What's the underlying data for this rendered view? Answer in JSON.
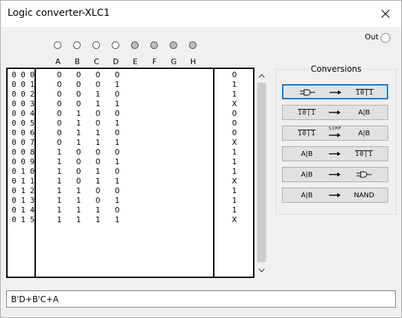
{
  "window": {
    "title": "Logic converter-XLC1"
  },
  "inputs": {
    "labels": [
      "A",
      "B",
      "C",
      "D",
      "E",
      "F",
      "G",
      "H"
    ],
    "active": [
      true,
      true,
      true,
      true,
      false,
      false,
      false,
      false
    ]
  },
  "output": {
    "label": "Out"
  },
  "truth_table": {
    "rows": [
      {
        "index": "000",
        "bits": [
          "0",
          "0",
          "0",
          "0"
        ],
        "out": "0"
      },
      {
        "index": "001",
        "bits": [
          "0",
          "0",
          "0",
          "1"
        ],
        "out": "1"
      },
      {
        "index": "002",
        "bits": [
          "0",
          "0",
          "1",
          "0"
        ],
        "out": "1"
      },
      {
        "index": "003",
        "bits": [
          "0",
          "0",
          "1",
          "1"
        ],
        "out": "X"
      },
      {
        "index": "004",
        "bits": [
          "0",
          "1",
          "0",
          "0"
        ],
        "out": "0"
      },
      {
        "index": "005",
        "bits": [
          "0",
          "1",
          "0",
          "1"
        ],
        "out": "0"
      },
      {
        "index": "006",
        "bits": [
          "0",
          "1",
          "1",
          "0"
        ],
        "out": "0"
      },
      {
        "index": "007",
        "bits": [
          "0",
          "1",
          "1",
          "1"
        ],
        "out": "X"
      },
      {
        "index": "008",
        "bits": [
          "1",
          "0",
          "0",
          "0"
        ],
        "out": "1"
      },
      {
        "index": "009",
        "bits": [
          "1",
          "0",
          "0",
          "1"
        ],
        "out": "1"
      },
      {
        "index": "010",
        "bits": [
          "1",
          "0",
          "1",
          "0"
        ],
        "out": "1"
      },
      {
        "index": "011",
        "bits": [
          "1",
          "0",
          "1",
          "1"
        ],
        "out": "X"
      },
      {
        "index": "012",
        "bits": [
          "1",
          "1",
          "0",
          "0"
        ],
        "out": "1"
      },
      {
        "index": "013",
        "bits": [
          "1",
          "1",
          "0",
          "1"
        ],
        "out": "1"
      },
      {
        "index": "014",
        "bits": [
          "1",
          "1",
          "1",
          "0"
        ],
        "out": "1"
      },
      {
        "index": "015",
        "bits": [
          "1",
          "1",
          "1",
          "1"
        ],
        "out": "X"
      }
    ]
  },
  "conversions": {
    "title": "Conversions",
    "buttons": [
      {
        "from": "circuit-icon",
        "to": "10|1",
        "focused": true
      },
      {
        "from": "10|1",
        "to": "A|B",
        "focused": false
      },
      {
        "from": "10|1",
        "to": "A|B",
        "middle": "SIMP",
        "focused": false
      },
      {
        "from": "A|B",
        "to": "10|1",
        "focused": false
      },
      {
        "from": "A|B",
        "to": "circuit-icon",
        "focused": false
      },
      {
        "from": "A|B",
        "to": "NAND",
        "focused": false
      }
    ]
  },
  "expression": {
    "value": "B'D+B'C+A"
  }
}
